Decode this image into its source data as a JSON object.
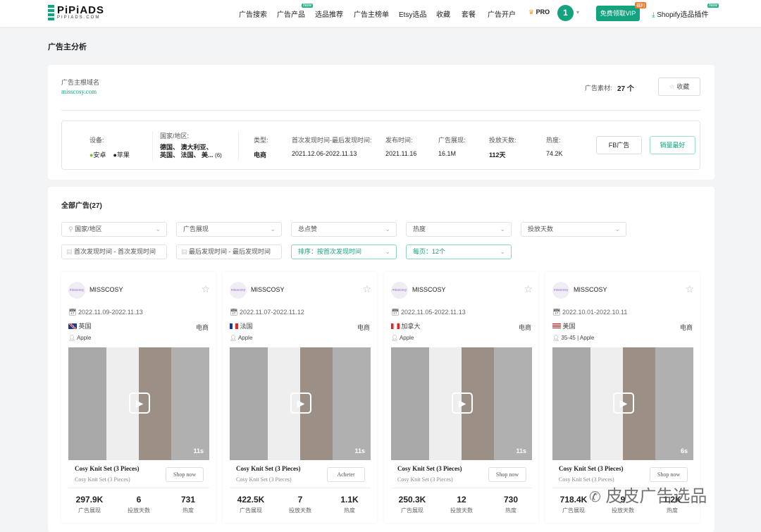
{
  "header": {
    "logo": "PiPiADS",
    "logo_sub": "PIPIADS.COM",
    "nav": [
      "广告搜索",
      "广告产品",
      "选品推荐",
      "广告主榜单",
      "Etsy选品",
      "收藏",
      "套餐",
      "广告开户"
    ],
    "new_badge": "New",
    "pro": "PRO",
    "avatar": "1",
    "vip_button": "免费领取VIP",
    "vip_badge": "福利",
    "plugin": "Shopify选品插件"
  },
  "page_title": "广告主分析",
  "advertiser": {
    "domain_label": "广告主根域名",
    "domain": "misscosy.com",
    "material_label": "广告素材:",
    "material_count": "27 个",
    "favorite": "收藏",
    "device_label": "设备:",
    "devices": [
      "安卓",
      "苹果"
    ],
    "country_label": "国家/地区:",
    "countries_line1": "德国、 澳大利亚、",
    "countries_line2": "英国、 法国、 美...",
    "country_count": "(6)",
    "type_label": "类型:",
    "type": "电商",
    "range_label": "首次发现时间-最后发现时间:",
    "range": "2021.12.06-2022.11.13",
    "publish_label": "发布时间:",
    "publish": "2021.11.16",
    "impr_label": "广告展现:",
    "impr": "16.1M",
    "days_label": "投放天数:",
    "days": "112天",
    "heat_label": "热度:",
    "heat": "74.2K",
    "fb_button": "FB广告",
    "best_button": "销量最好"
  },
  "all_ads": {
    "title": "全部广告(27)",
    "filters": [
      "国家/地区",
      "广告展现",
      "总点赞",
      "热度",
      "投放天数"
    ],
    "first_date": "首次发现时间 - 首次发现时间",
    "last_date": "最后发现时间 - 最后发现时间",
    "sort": "排序：按首次发现时间",
    "per_page": "每页：12个"
  },
  "stat_labels": [
    "广告展现",
    "投放天数",
    "热度"
  ],
  "ads": [
    {
      "name": "MISSCOSY",
      "date": "2022.11.09-2022.11.13",
      "country": "英国",
      "flag": "uk",
      "category": "电商",
      "device": "Apple",
      "duration": "11s",
      "title": "Cosy Knit Set (3 Pieces)",
      "subtitle": "Cosy Knit Set (3 Pieces)",
      "cta": "Shop now",
      "impr": "297.9K",
      "days": "6",
      "heat": "731"
    },
    {
      "name": "MISSCOSY",
      "date": "2022.11.07-2022.11.12",
      "country": "法国",
      "flag": "fr",
      "category": "电商",
      "device": "Apple",
      "duration": "11s",
      "title": "Cosy Knit Set (3 Pieces)",
      "subtitle": "Cosy Knit Set (3 Pieces)",
      "cta": "Acheter",
      "impr": "422.5K",
      "days": "7",
      "heat": "1.1K"
    },
    {
      "name": "MISSCOSY",
      "date": "2022.11.05-2022.11.13",
      "country": "加拿大",
      "flag": "ca",
      "category": "电商",
      "device": "Apple",
      "duration": "11s",
      "title": "Cosy Knit Set (3 Pieces)",
      "subtitle": "Cosy Knit Set (3 Pieces)",
      "cta": "Shop now",
      "impr": "250.3K",
      "days": "12",
      "heat": "730"
    },
    {
      "name": "MISSCOSY",
      "date": "2022.10.01-2022.10.11",
      "country": "美国",
      "flag": "us",
      "category": "电商",
      "device": "35-45 | Apple",
      "duration": "6s",
      "title": "Cosy Knit Set (3 Pieces)",
      "subtitle": "Cosy Knit Set (3 Pieces)",
      "cta": "Shop now",
      "impr": "718.4K",
      "days": "9",
      "heat": "1.2K"
    }
  ],
  "watermark": "皮皮广告选品",
  "colors": {
    "brand": "#14a37f"
  }
}
